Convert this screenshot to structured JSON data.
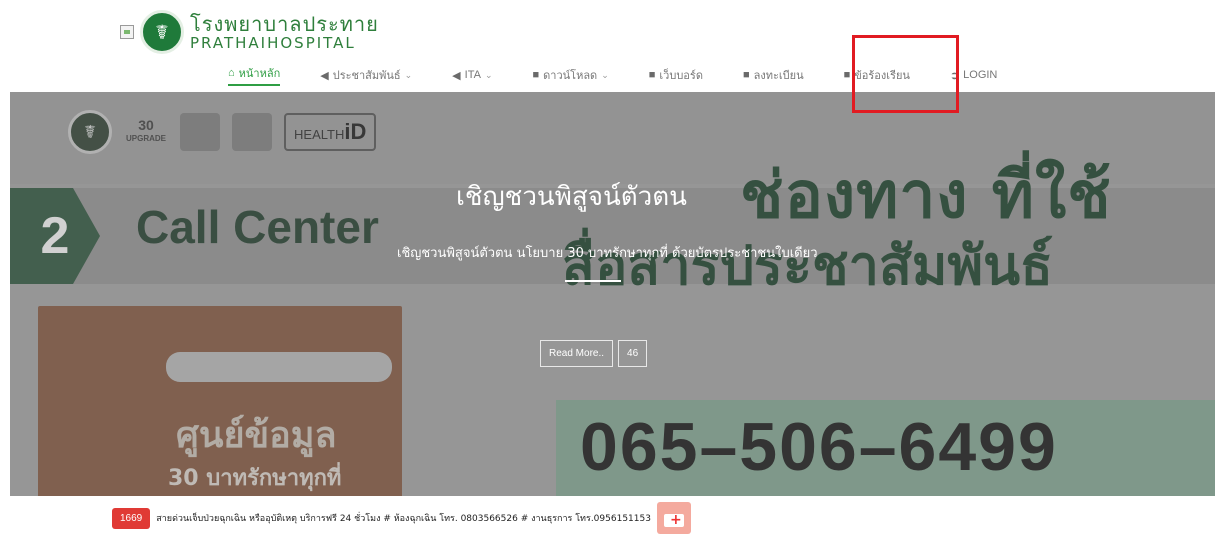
{
  "logo": {
    "thai_name": "โรงพยาบาลประทาย",
    "english_name": "PRATHAIHOSPITAL"
  },
  "nav": {
    "items": [
      {
        "label": "หน้าหลัก",
        "icon": "home-icon",
        "has_caret": false,
        "active": true
      },
      {
        "label": "ประชาสัมพันธ์",
        "icon": "megaphone-icon",
        "has_caret": true
      },
      {
        "label": "ITA",
        "icon": "megaphone-icon",
        "has_caret": true
      },
      {
        "label": "ดาวน์โหลด",
        "icon": "comment-icon",
        "has_caret": true
      },
      {
        "label": "เว็บบอร์ด",
        "icon": "comment-icon",
        "has_caret": false
      },
      {
        "label": "ลงทะเบียน",
        "icon": "comment-icon",
        "has_caret": false
      },
      {
        "label": "ข้อร้องเรียน",
        "icon": "comment-icon",
        "has_caret": false
      },
      {
        "label": "LOGIN",
        "icon": "login-icon",
        "has_caret": false
      }
    ],
    "highlight_color": "#e11b22"
  },
  "hero": {
    "banner": {
      "badge_upgrade": "UPGRADE",
      "health_id_prefix": "HEALTH",
      "health_id_suffix": "iD",
      "call_number": "2",
      "call_center": "Call Center",
      "channel_line1": "ช่องทาง ที่ใช้",
      "channel_line2": "สื่อสารประชาสัมพันธ์",
      "info_center_line1": "ศูนย์ข้อมูล",
      "info_center_line2": "30 บาทรักษาทุกที่",
      "phone": "065–506–6499"
    },
    "slide": {
      "title": "เชิญชวนพิสูจน์ตัวตน",
      "subtitle": "เชิญชวนพิสูจน์ตัวตน นโยบาย 30 บาทรักษาทุกที่ ด้วยบัตรประชาชนใบเดียว",
      "read_more": "Read More..",
      "count": "46"
    }
  },
  "ticker": {
    "badge": "1669",
    "text": "สายด่วนเจ็บป่วยฉุกเฉิน หรืออุบัติเหตุ บริการฟรี 24 ชั่วโมง # ห้องฉุกเฉิน โทร. 0803566526 # งานธุรการ โทร.0956151153",
    "badge_color": "#e03a35"
  }
}
